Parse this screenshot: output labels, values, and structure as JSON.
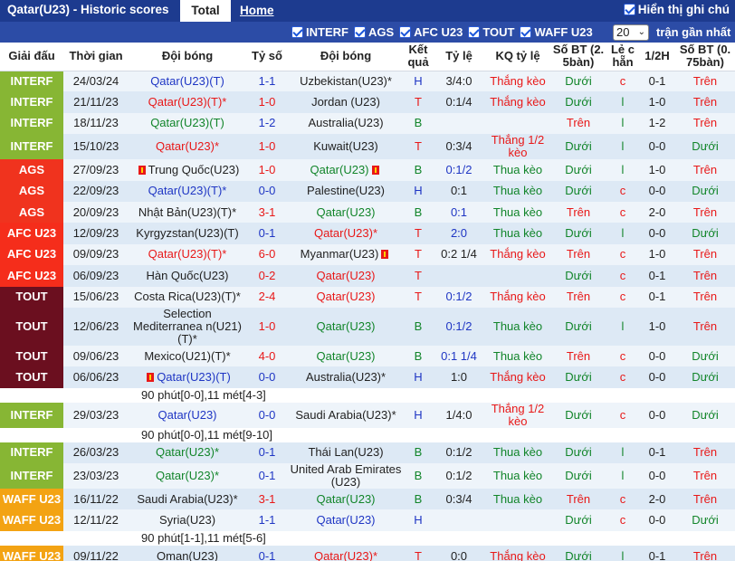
{
  "header": {
    "title": "Qatar(U23) - Historic scores",
    "tab_total": "Total",
    "tab_home": "Home",
    "show_hint": "Hiển thị ghi chú"
  },
  "filters": {
    "items": [
      "INTERF",
      "AGS",
      "AFC U23",
      "TOUT",
      "WAFF U23"
    ],
    "count_value": "20",
    "count_label": "trận gần nhất"
  },
  "columns": [
    "Giải đấu",
    "Thời gian",
    "Đội bóng",
    "Tỷ số",
    "Đội bóng",
    "Kết quả",
    "Tỷ lệ",
    "KQ tỷ lệ",
    "Số BT (2.5bàn)",
    "Lẻ chẵn",
    "1/2H",
    "Số BT (0.75bàn)"
  ],
  "column_lines": [
    [
      "Giải đấu"
    ],
    [
      "Thời gian"
    ],
    [
      "Đội bóng"
    ],
    [
      "Tỷ số"
    ],
    [
      "Đội bóng"
    ],
    [
      "Kết",
      "quả"
    ],
    [
      "Tỷ lệ"
    ],
    [
      "KQ tỷ lệ"
    ],
    [
      "Số BT (2.",
      "5bàn)"
    ],
    [
      "Lẻ c",
      "hẵn"
    ],
    [
      "1/2H"
    ],
    [
      "Số BT (0.",
      "75bàn)"
    ]
  ],
  "colors": {
    "INTERF": "#87b634",
    "AGS": "#f0331e",
    "AFC U23": "#f52d1b",
    "TOUT": "#6b0f1f",
    "WAFF U23": "#f3a313",
    "header_bar": "#1d3b8f",
    "filter_bar": "#2c4ca6",
    "green": "#12852a",
    "red": "#e81818",
    "blue": "#1f36c4"
  },
  "rows": [
    {
      "league": "INTERF",
      "date": "24/03/24",
      "home": "Qatar(U23)(T)",
      "home_color": "blue",
      "home_flag": false,
      "score": "1-1",
      "score_color": "blue",
      "away": "Uzbekistan(U23)*",
      "away_color": "black",
      "away_flag": false,
      "result": "H",
      "result_color": "blue",
      "odds": "3/4:0",
      "odds_color": "black",
      "kq": "Thắng kèo",
      "kq_color": "red",
      "bt25": "Dưới",
      "bt25_color": "green",
      "lec": "c",
      "lec_color": "red",
      "half": "0-1",
      "bt075": "Trên",
      "bt075_color": "red"
    },
    {
      "league": "INTERF",
      "date": "21/11/23",
      "home": "Qatar(U23)(T)*",
      "home_color": "red",
      "home_flag": false,
      "score": "1-0",
      "score_color": "red",
      "away": "Jordan (U23)",
      "away_color": "black",
      "away_flag": false,
      "result": "T",
      "result_color": "red",
      "odds": "0:1/4",
      "odds_color": "black",
      "kq": "Thắng kèo",
      "kq_color": "red",
      "bt25": "Dưới",
      "bt25_color": "green",
      "lec": "l",
      "lec_color": "green",
      "half": "1-0",
      "bt075": "Trên",
      "bt075_color": "red"
    },
    {
      "league": "INTERF",
      "date": "18/11/23",
      "home": "Qatar(U23)(T)",
      "home_color": "green",
      "home_flag": false,
      "score": "1-2",
      "score_color": "blue",
      "away": "Australia(U23)",
      "away_color": "black",
      "away_flag": false,
      "result": "B",
      "result_color": "green",
      "odds": "",
      "odds_color": "black",
      "kq": "",
      "kq_color": "black",
      "bt25": "Trên",
      "bt25_color": "red",
      "lec": "l",
      "lec_color": "green",
      "half": "1-2",
      "bt075": "Trên",
      "bt075_color": "red"
    },
    {
      "league": "INTERF",
      "date": "15/10/23",
      "home": "Qatar(U23)*",
      "home_color": "red",
      "home_flag": false,
      "score": "1-0",
      "score_color": "red",
      "away": "Kuwait(U23)",
      "away_color": "black",
      "away_flag": false,
      "result": "T",
      "result_color": "red",
      "odds": "0:3/4",
      "odds_color": "black",
      "kq": "Thắng 1/2 kèo",
      "kq_color": "red",
      "kq_wrap": true,
      "bt25": "Dưới",
      "bt25_color": "green",
      "lec": "l",
      "lec_color": "green",
      "half": "0-0",
      "bt075": "Dưới",
      "bt075_color": "green"
    },
    {
      "league": "AGS",
      "date": "27/09/23",
      "home": "Trung Quốc(U23)",
      "home_color": "black",
      "home_flag": true,
      "score": "1-0",
      "score_color": "red",
      "away": "Qatar(U23)",
      "away_color": "green",
      "away_flag": true,
      "result": "B",
      "result_color": "green",
      "odds": "0:1/2",
      "odds_color": "blue",
      "kq": "Thua kèo",
      "kq_color": "green",
      "bt25": "Dưới",
      "bt25_color": "green",
      "lec": "l",
      "lec_color": "green",
      "half": "1-0",
      "bt075": "Trên",
      "bt075_color": "red"
    },
    {
      "league": "AGS",
      "date": "22/09/23",
      "home": "Qatar(U23)(T)*",
      "home_color": "blue",
      "home_flag": false,
      "score": "0-0",
      "score_color": "blue",
      "away": "Palestine(U23)",
      "away_color": "black",
      "away_flag": false,
      "result": "H",
      "result_color": "blue",
      "odds": "0:1",
      "odds_color": "black",
      "kq": "Thua kèo",
      "kq_color": "green",
      "bt25": "Dưới",
      "bt25_color": "green",
      "lec": "c",
      "lec_color": "red",
      "half": "0-0",
      "bt075": "Dưới",
      "bt075_color": "green"
    },
    {
      "league": "AGS",
      "date": "20/09/23",
      "home": "Nhật Bản(U23)(T)*",
      "home_color": "black",
      "home_flag": false,
      "score": "3-1",
      "score_color": "red",
      "away": "Qatar(U23)",
      "away_color": "green",
      "away_flag": false,
      "result": "B",
      "result_color": "green",
      "odds": "0:1",
      "odds_color": "blue",
      "kq": "Thua kèo",
      "kq_color": "green",
      "bt25": "Trên",
      "bt25_color": "red",
      "lec": "c",
      "lec_color": "red",
      "half": "2-0",
      "bt075": "Trên",
      "bt075_color": "red"
    },
    {
      "league": "AFC U23",
      "date": "12/09/23",
      "home": "Kyrgyzstan(U23)(T)",
      "home_color": "black",
      "home_flag": false,
      "score": "0-1",
      "score_color": "blue",
      "away": "Qatar(U23)*",
      "away_color": "red",
      "away_flag": false,
      "result": "T",
      "result_color": "red",
      "odds": "2:0",
      "odds_color": "blue",
      "kq": "Thua kèo",
      "kq_color": "green",
      "bt25": "Dưới",
      "bt25_color": "green",
      "lec": "l",
      "lec_color": "green",
      "half": "0-0",
      "bt075": "Dưới",
      "bt075_color": "green"
    },
    {
      "league": "AFC U23",
      "date": "09/09/23",
      "home": "Qatar(U23)(T)*",
      "home_color": "red",
      "home_flag": false,
      "score": "6-0",
      "score_color": "red",
      "away": "Myanmar(U23)",
      "away_color": "black",
      "away_flag": true,
      "result": "T",
      "result_color": "red",
      "odds": "0:2 1/4",
      "odds_color": "black",
      "kq": "Thắng kèo",
      "kq_color": "red",
      "bt25": "Trên",
      "bt25_color": "red",
      "lec": "c",
      "lec_color": "red",
      "half": "1-0",
      "bt075": "Trên",
      "bt075_color": "red"
    },
    {
      "league": "AFC U23",
      "date": "06/09/23",
      "home": "Hàn Quốc(U23)",
      "home_color": "black",
      "home_flag": false,
      "score": "0-2",
      "score_color": "red",
      "away": "Qatar(U23)",
      "away_color": "red",
      "away_flag": false,
      "result": "T",
      "result_color": "red",
      "odds": "",
      "odds_color": "black",
      "kq": "",
      "kq_color": "black",
      "bt25": "Dưới",
      "bt25_color": "green",
      "lec": "c",
      "lec_color": "red",
      "half": "0-1",
      "bt075": "Trên",
      "bt075_color": "red"
    },
    {
      "league": "TOUT",
      "date": "15/06/23",
      "home": "Costa Rica(U23)(T)*",
      "home_color": "black",
      "home_flag": false,
      "score": "2-4",
      "score_color": "red",
      "away": "Qatar(U23)",
      "away_color": "red",
      "away_flag": false,
      "result": "T",
      "result_color": "red",
      "odds": "0:1/2",
      "odds_color": "blue",
      "kq": "Thắng kèo",
      "kq_color": "red",
      "bt25": "Trên",
      "bt25_color": "red",
      "lec": "c",
      "lec_color": "red",
      "half": "0-1",
      "bt075": "Trên",
      "bt075_color": "red"
    },
    {
      "league": "TOUT",
      "date": "12/06/23",
      "home": "Selection Mediterranea n(U21)(T)*",
      "home_color": "black",
      "home_flag": false,
      "home_wrap": true,
      "score": "1-0",
      "score_color": "red",
      "away": "Qatar(U23)",
      "away_color": "green",
      "away_flag": false,
      "result": "B",
      "result_color": "green",
      "odds": "0:1/2",
      "odds_color": "blue",
      "kq": "Thua kèo",
      "kq_color": "green",
      "bt25": "Dưới",
      "bt25_color": "green",
      "lec": "l",
      "lec_color": "green",
      "half": "1-0",
      "bt075": "Trên",
      "bt075_color": "red"
    },
    {
      "league": "TOUT",
      "date": "09/06/23",
      "home": "Mexico(U21)(T)*",
      "home_color": "black",
      "home_flag": false,
      "score": "4-0",
      "score_color": "red",
      "away": "Qatar(U23)",
      "away_color": "green",
      "away_flag": false,
      "result": "B",
      "result_color": "green",
      "odds": "0:1 1/4",
      "odds_color": "blue",
      "kq": "Thua kèo",
      "kq_color": "green",
      "bt25": "Trên",
      "bt25_color": "red",
      "lec": "c",
      "lec_color": "red",
      "half": "0-0",
      "bt075": "Dưới",
      "bt075_color": "green"
    },
    {
      "league": "TOUT",
      "date": "06/06/23",
      "home": "Qatar(U23)(T)",
      "home_color": "blue",
      "home_flag": true,
      "score": "0-0",
      "score_color": "blue",
      "away": "Australia(U23)*",
      "away_color": "black",
      "away_flag": false,
      "result": "H",
      "result_color": "blue",
      "odds": "1:0",
      "odds_color": "black",
      "kq": "Thắng kèo",
      "kq_color": "red",
      "bt25": "Dưới",
      "bt25_color": "green",
      "lec": "c",
      "lec_color": "red",
      "half": "0-0",
      "bt075": "Dưới",
      "bt075_color": "green",
      "note": "90 phút[0-0],11 mét[4-3]"
    },
    {
      "league": "INTERF",
      "date": "29/03/23",
      "home": "Qatar(U23)",
      "home_color": "blue",
      "home_flag": false,
      "score": "0-0",
      "score_color": "blue",
      "away": "Saudi Arabia(U23)*",
      "away_color": "black",
      "away_flag": false,
      "result": "H",
      "result_color": "blue",
      "odds": "1/4:0",
      "odds_color": "black",
      "kq": "Thắng 1/2 kèo",
      "kq_color": "red",
      "kq_wrap": true,
      "bt25": "Dưới",
      "bt25_color": "green",
      "lec": "c",
      "lec_color": "red",
      "half": "0-0",
      "bt075": "Dưới",
      "bt075_color": "green",
      "note": "90 phút[0-0],11 mét[9-10]"
    },
    {
      "league": "INTERF",
      "date": "26/03/23",
      "home": "Qatar(U23)*",
      "home_color": "green",
      "home_flag": false,
      "score": "0-1",
      "score_color": "blue",
      "away": "Thái Lan(U23)",
      "away_color": "black",
      "away_flag": false,
      "result": "B",
      "result_color": "green",
      "odds": "0:1/2",
      "odds_color": "black",
      "kq": "Thua kèo",
      "kq_color": "green",
      "bt25": "Dưới",
      "bt25_color": "green",
      "lec": "l",
      "lec_color": "green",
      "half": "0-1",
      "bt075": "Trên",
      "bt075_color": "red"
    },
    {
      "league": "INTERF",
      "date": "23/03/23",
      "home": "Qatar(U23)*",
      "home_color": "green",
      "home_flag": false,
      "score": "0-1",
      "score_color": "blue",
      "away": "United Arab Emirates (U23)",
      "away_color": "black",
      "away_flag": false,
      "away_wrap": true,
      "result": "B",
      "result_color": "green",
      "odds": "0:1/2",
      "odds_color": "black",
      "kq": "Thua kèo",
      "kq_color": "green",
      "bt25": "Dưới",
      "bt25_color": "green",
      "lec": "l",
      "lec_color": "green",
      "half": "0-0",
      "bt075": "Trên",
      "bt075_color": "red"
    },
    {
      "league": "WAFF U23",
      "date": "16/11/22",
      "home": "Saudi Arabia(U23)*",
      "home_color": "black",
      "home_flag": false,
      "score": "3-1",
      "score_color": "red",
      "away": "Qatar(U23)",
      "away_color": "green",
      "away_flag": false,
      "result": "B",
      "result_color": "green",
      "odds": "0:3/4",
      "odds_color": "black",
      "kq": "Thua kèo",
      "kq_color": "green",
      "bt25": "Trên",
      "bt25_color": "red",
      "lec": "c",
      "lec_color": "red",
      "half": "2-0",
      "bt075": "Trên",
      "bt075_color": "red"
    },
    {
      "league": "WAFF U23",
      "date": "12/11/22",
      "home": "Syria(U23)",
      "home_color": "black",
      "home_flag": false,
      "score": "1-1",
      "score_color": "blue",
      "away": "Qatar(U23)",
      "away_color": "blue",
      "away_flag": false,
      "result": "H",
      "result_color": "blue",
      "odds": "",
      "odds_color": "black",
      "kq": "",
      "kq_color": "black",
      "bt25": "Dưới",
      "bt25_color": "green",
      "lec": "c",
      "lec_color": "red",
      "half": "0-0",
      "bt075": "Dưới",
      "bt075_color": "green",
      "note": "90 phút[1-1],11 mét[5-6]"
    },
    {
      "league": "WAFF U23",
      "date": "09/11/22",
      "home": "Oman(U23)",
      "home_color": "black",
      "home_flag": false,
      "score": "0-1",
      "score_color": "blue",
      "away": "Qatar(U23)*",
      "away_color": "red",
      "away_flag": false,
      "result": "T",
      "result_color": "red",
      "odds": "0:0",
      "odds_color": "black",
      "kq": "Thắng kèo",
      "kq_color": "red",
      "bt25": "Dưới",
      "bt25_color": "green",
      "lec": "l",
      "lec_color": "green",
      "half": "0-1",
      "bt075": "Trên",
      "bt075_color": "red"
    }
  ]
}
